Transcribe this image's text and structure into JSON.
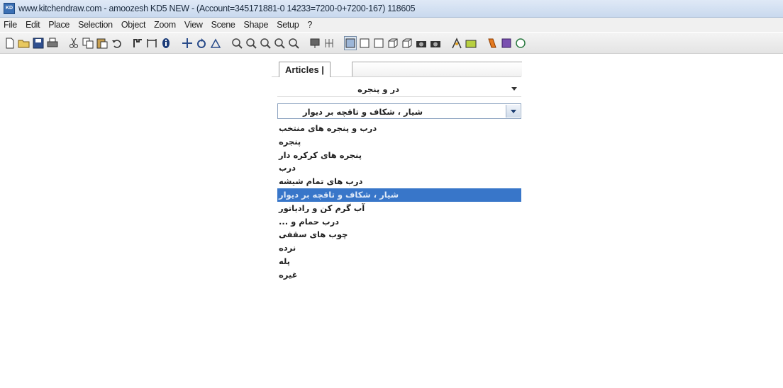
{
  "window": {
    "app_icon_text": "KD",
    "title": "www.kitchendraw.com - amoozesh KD5 NEW - (Account=345171881-0 14233=7200-0+7200-167) 118605"
  },
  "menu": [
    "File",
    "Edit",
    "Place",
    "Selection",
    "Object",
    "Zoom",
    "View",
    "Scene",
    "Shape",
    "Setup",
    "?"
  ],
  "toolbar": {
    "icons": [
      "new-file-icon",
      "open-folder-icon",
      "save-icon",
      "print-icon",
      "cut-icon",
      "copy-icon",
      "paste-icon",
      "undo-icon",
      "measure-icon",
      "dimension-icon",
      "info-icon",
      "move-icon",
      "rotate-icon",
      "mirror-icon",
      "zoom-in-icon",
      "zoom-out-icon",
      "zoom-window-icon",
      "zoom-all-icon",
      "zoom-previous-icon",
      "render-icon",
      "elevation-icon",
      "plan-view-icon",
      "front-view-icon",
      "side-view-icon",
      "iso-view-icon",
      "perspective-view-icon",
      "camera-icon",
      "camera2-icon",
      "light-icon",
      "shape-icon",
      "catalog-icon",
      "texture-icon",
      "web-icon"
    ]
  },
  "panel": {
    "tab_label": "Articles |",
    "catalog_select": "در و پنجره",
    "category_select": "شیار ، شکاف و تاقچه بر دیوار",
    "items": [
      "درب و پنجره های منتخب",
      "پنجره",
      "پنجره های کرکره دار",
      "درب",
      "درب های تمام شیشه",
      "شیار ، شکاف و تاقچه بر دیوار",
      "آب گرم کن و رادیاتور",
      "درب حمام و ...",
      "چوب های سقفی",
      "نرده",
      "پله",
      "غیره"
    ],
    "selected_index": 5
  }
}
